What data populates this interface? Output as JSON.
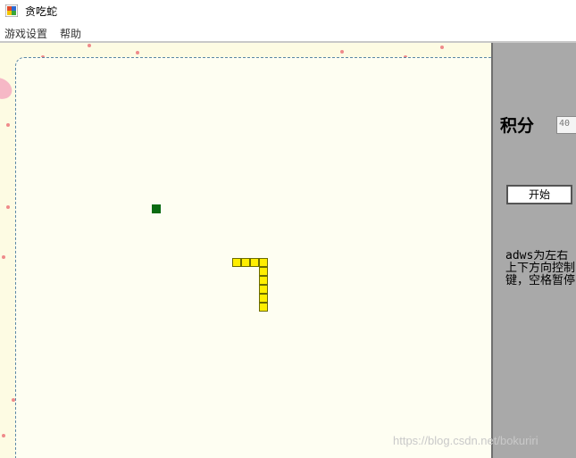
{
  "window": {
    "title": "贪吃蛇",
    "icon": "app-window-icon"
  },
  "menu": {
    "items": [
      {
        "label": "游戏设置"
      },
      {
        "label": "帮助"
      }
    ]
  },
  "panel": {
    "score_label": "积分",
    "score_value": "40",
    "start_button_label": "开始",
    "help_text": "adws为左右上下方向控制键，空格暂停"
  },
  "game": {
    "snake_color": "#ffee00",
    "food_color": "#0b6b12"
  },
  "watermark": "https://blog.csdn.net/bokuriri"
}
